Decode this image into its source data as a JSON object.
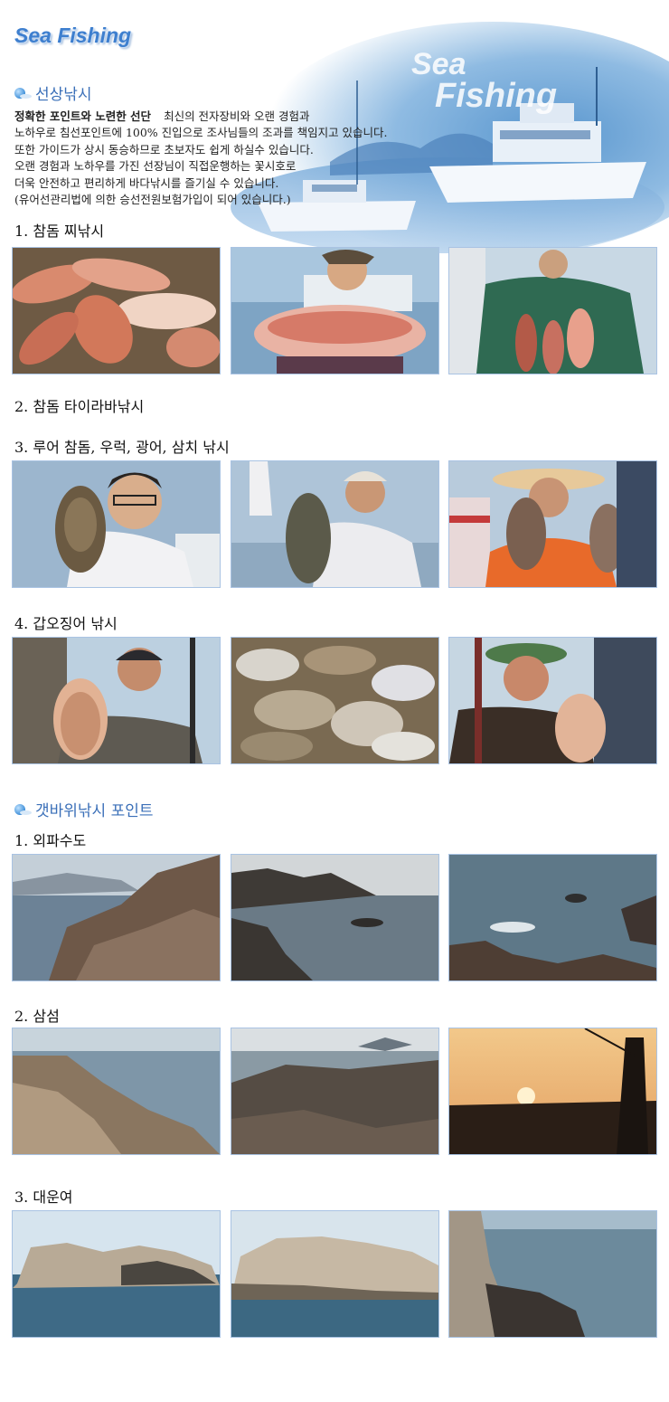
{
  "header": {
    "logo": "Sea Fishing",
    "banner_line1": "Sea",
    "banner_line2": "Fishing"
  },
  "section1": {
    "title": "선상낚시",
    "intro_lead": "정확한 포인트와 노련한 선단",
    "intro_lines": [
      "최신의 전자장비와 오랜 경험과",
      "노하우로 침선포인트에 100% 진입으로 조사님들의 조과를 책임지고 있습니다.",
      "또한 가이드가 상시 동승하므로 초보자도 쉽게 하실수 있습니다.",
      "오랜 경험과 노하우를 가진 선장님이 직접운행하는 꽃시호로",
      "더욱 안전하고  편리하게 바다낚시를 즐기실 수 있습니다.",
      "(유어선관리법에 의한 승선전원보험가입이 되어 있습니다.)"
    ],
    "items": [
      {
        "label": "1. 참돔 찌낚시"
      },
      {
        "label": "2. 참돔 타이라바낚시"
      },
      {
        "label": "3. 루어 참돔, 우럭, 광어, 삼치 낚시"
      },
      {
        "label": "4. 갑오징어 낚시"
      }
    ]
  },
  "section2": {
    "title": "갯바위낚시 포인트",
    "items": [
      {
        "label": "1. 외파수도"
      },
      {
        "label": "2. 삼섬"
      },
      {
        "label": "3. 대운여"
      }
    ]
  },
  "colors": {
    "accent": "#3a6fb8",
    "photo_border": "#a9c3e3",
    "logo": "#3e7fcf"
  }
}
